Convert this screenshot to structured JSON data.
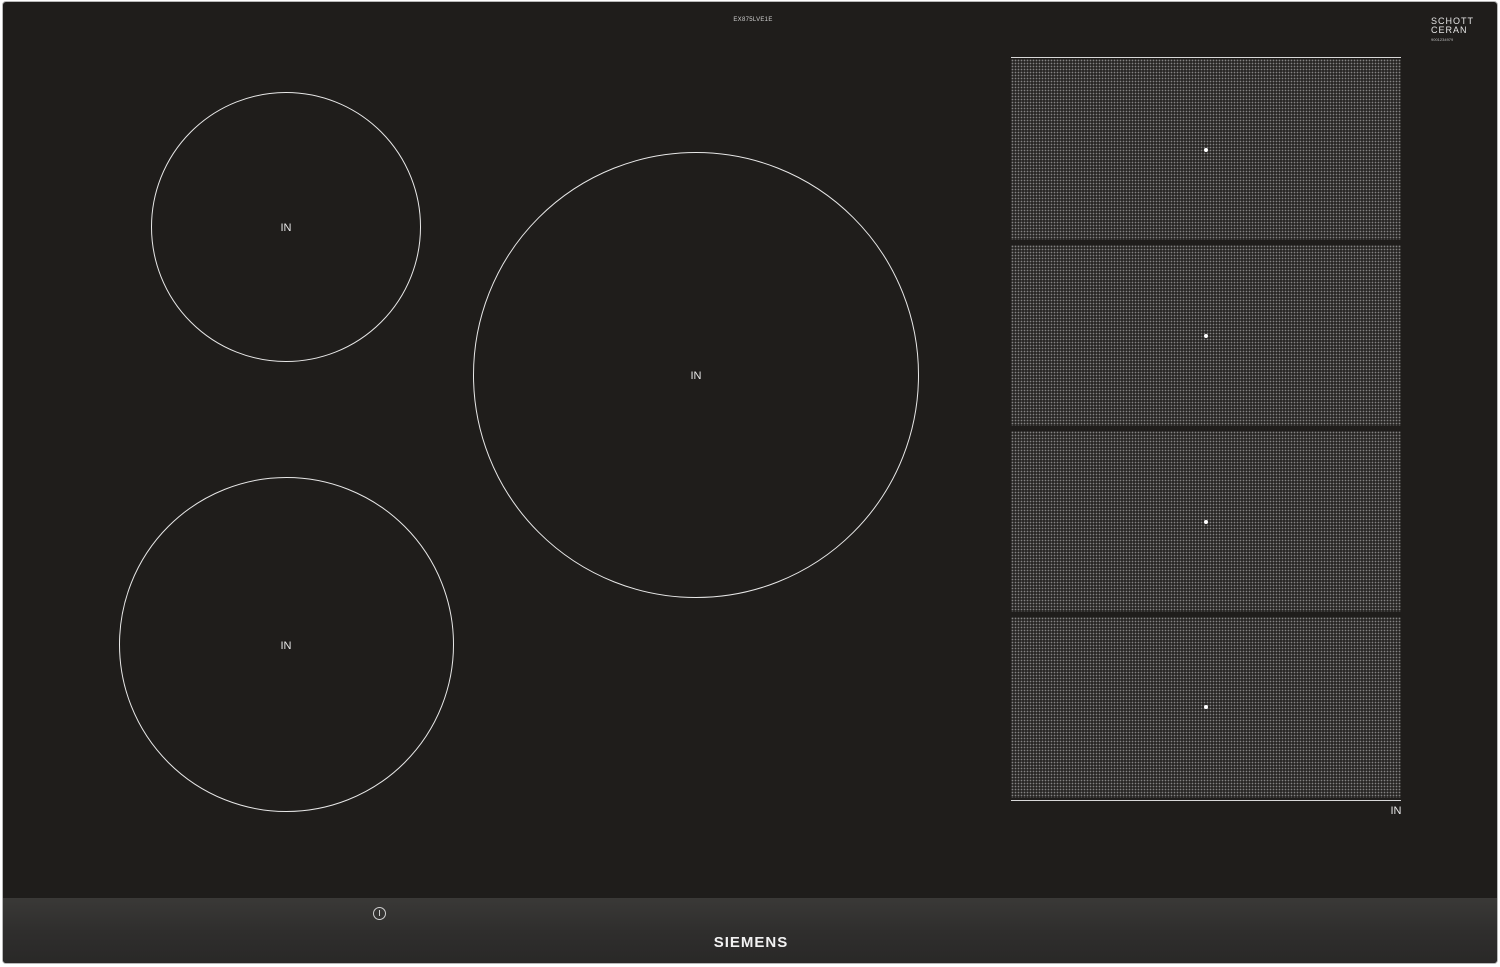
{
  "hob": {
    "model_code": "EX875LVE1E",
    "glass_brand": {
      "line1": "SCHOTT",
      "line2": "CERAN",
      "line3": "9001234979"
    },
    "zones": [
      {
        "label": "IN"
      },
      {
        "label": "IN"
      },
      {
        "label": "IN"
      }
    ],
    "flex_zone": {
      "label": "IN",
      "segments": 4
    },
    "controls": {
      "power_icon": "power-icon"
    },
    "brand": "SIEMENS",
    "colors": {
      "glass": "#1f1d1b",
      "line": "#e8e8e8",
      "frame": "#b8b8b8"
    }
  }
}
